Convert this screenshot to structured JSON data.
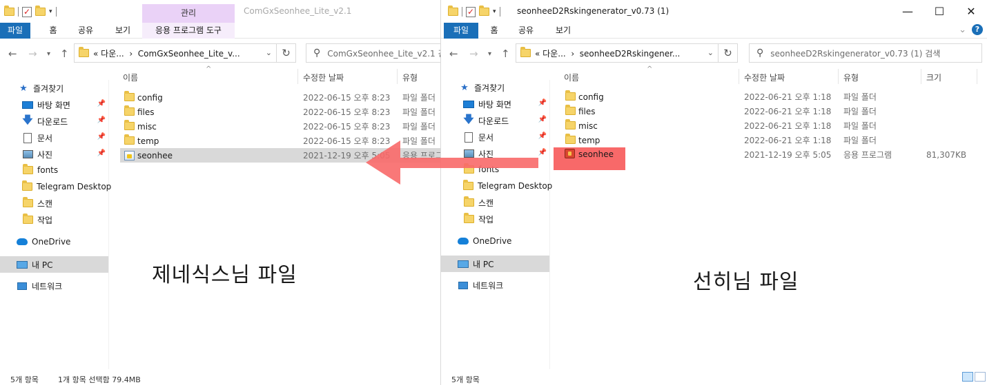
{
  "left_window": {
    "title": "ComGxSeonhee_Lite_v2.1",
    "context_header": "관리",
    "ribbon": {
      "file": "파일",
      "home": "홈",
      "share": "공유",
      "view": "보기",
      "app_tools": "응용 프로그램 도구"
    },
    "address": {
      "prefix": "«",
      "crumb_1": "다운...",
      "separator": "›",
      "crumb_2": "ComGxSeonhee_Lite_v..."
    },
    "search_placeholder": "ComGxSeonhee_Lite_v2.1 검",
    "columns": {
      "name": "이름",
      "modified": "수정한 날짜",
      "type": "유형"
    },
    "files": [
      {
        "name": "config",
        "date": "2022-06-15 오후 8:23",
        "type": "파일 폴더"
      },
      {
        "name": "files",
        "date": "2022-06-15 오후 8:23",
        "type": "파일 폴더"
      },
      {
        "name": "misc",
        "date": "2022-06-15 오후 8:23",
        "type": "파일 폴더"
      },
      {
        "name": "temp",
        "date": "2022-06-15 오후 8:23",
        "type": "파일 폴더"
      },
      {
        "name": "seonhee",
        "date": "2021-12-19 오후 5:05",
        "type": "응용 프로그"
      }
    ],
    "status": {
      "count": "5개 항목",
      "selection": "1개 항목 선택함 79.4MB"
    },
    "caption": "제네식스님 파일"
  },
  "right_window": {
    "title": "seonheeD2Rskingenerator_v0.73 (1)",
    "ribbon": {
      "file": "파일",
      "home": "홈",
      "share": "공유",
      "view": "보기"
    },
    "address": {
      "prefix": "«",
      "crumb_1": "다운...",
      "separator": "›",
      "crumb_2": "seonheeD2Rskingener..."
    },
    "search_placeholder": "seonheeD2Rskingenerator_v0.73 (1) 검색",
    "columns": {
      "name": "이름",
      "modified": "수정한 날짜",
      "type": "유형",
      "size": "크기"
    },
    "files": [
      {
        "name": "config",
        "date": "2022-06-21 오후 1:18",
        "type": "파일 폴더",
        "size": ""
      },
      {
        "name": "files",
        "date": "2022-06-21 오후 1:18",
        "type": "파일 폴더",
        "size": ""
      },
      {
        "name": "misc",
        "date": "2022-06-21 오후 1:18",
        "type": "파일 폴더",
        "size": ""
      },
      {
        "name": "temp",
        "date": "2022-06-21 오후 1:18",
        "type": "파일 폴더",
        "size": ""
      },
      {
        "name": "seonhee",
        "date": "2021-12-19 오후 5:05",
        "type": "응용 프로그램",
        "size": "81,307KB"
      }
    ],
    "status": {
      "count": "5개 항목"
    },
    "caption": "선히님 파일"
  },
  "nav_pane": {
    "quick_access": "즐겨찾기",
    "desktop": "바탕 화면",
    "downloads": "다운로드",
    "documents": "문서",
    "pictures": "사진",
    "fonts": "fonts",
    "telegram": "Telegram Desktop",
    "scan": "스캔",
    "work": "작업",
    "onedrive": "OneDrive",
    "this_pc": "내 PC",
    "network": "네트워크"
  },
  "window_controls": {
    "minimize": "—",
    "maximize": "☐",
    "close": "✕"
  },
  "annotation_color": "#f86969"
}
